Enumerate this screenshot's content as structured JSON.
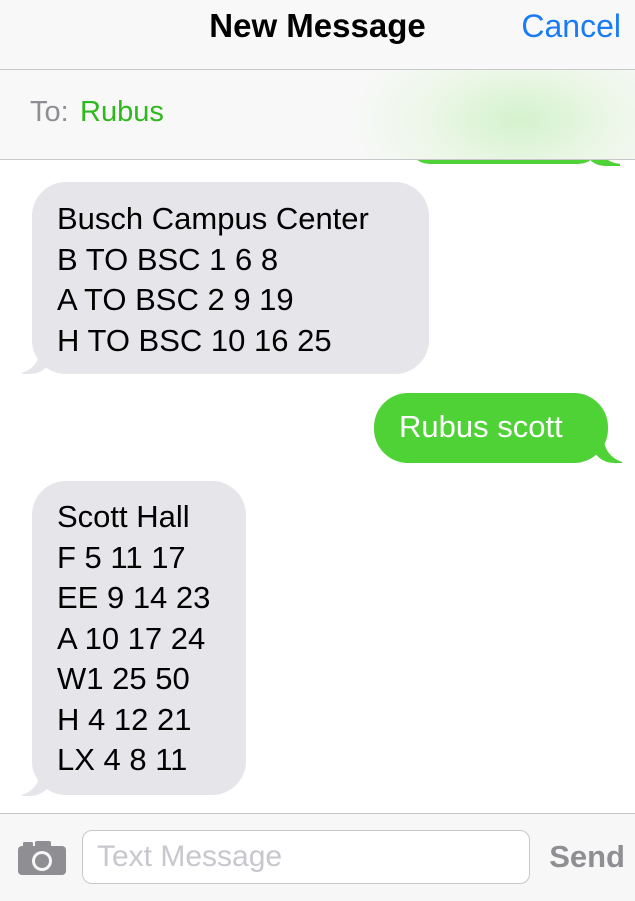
{
  "nav": {
    "title": "New Message",
    "cancel_label": "Cancel"
  },
  "to": {
    "label": "To:",
    "recipient": "Rubus"
  },
  "messages": [
    {
      "direction": "incoming",
      "text": "Busch Campus Center\nB TO BSC 1 6 8\nA TO BSC 2 9 19\nH TO BSC 10 16 25"
    },
    {
      "direction": "outgoing",
      "text": "Rubus scott"
    },
    {
      "direction": "incoming",
      "text": "Scott Hall\nF 5 11 17\nEE 9 14 23\nA 10 17 24\nW1 25 50\nH 4 12 21\nLX 4 8 11"
    }
  ],
  "composer": {
    "placeholder": "Text Message",
    "value": "",
    "send_label": "Send",
    "camera_icon": "camera-icon"
  },
  "colors": {
    "accent_blue": "#1a7cf5",
    "outgoing_bubble": "#4fd235",
    "incoming_bubble": "#e5e5ea",
    "recipient_green": "#2fb81e",
    "send_disabled_gray": "#8e8e93"
  }
}
